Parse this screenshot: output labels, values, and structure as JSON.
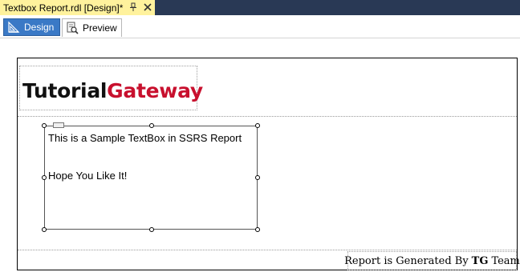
{
  "document_tab": {
    "title": "Textbox Report.rdl [Design]*",
    "pin_icon": "pin-icon",
    "close_icon": "close-icon"
  },
  "view_tabs": [
    {
      "label": "Design",
      "icon": "design-icon",
      "active": true
    },
    {
      "label": "Preview",
      "icon": "preview-icon",
      "active": false
    }
  ],
  "report": {
    "logo": {
      "part1": "Tutorial",
      "part2": "Gateway",
      "colors": {
        "part1": "#111111",
        "part2": "#c8102e"
      }
    },
    "textbox": {
      "line1": "This is a Sample TextBox in SSRS Report",
      "line2": "Hope You Like It!"
    },
    "footer": {
      "prefix": "Report is Generated By",
      "bold": "TG",
      "suffix": "Team"
    }
  },
  "colors": {
    "doc_strip": "#293955",
    "active_doc_tab": "#fff29d",
    "design_tab": "#3a79c6"
  }
}
